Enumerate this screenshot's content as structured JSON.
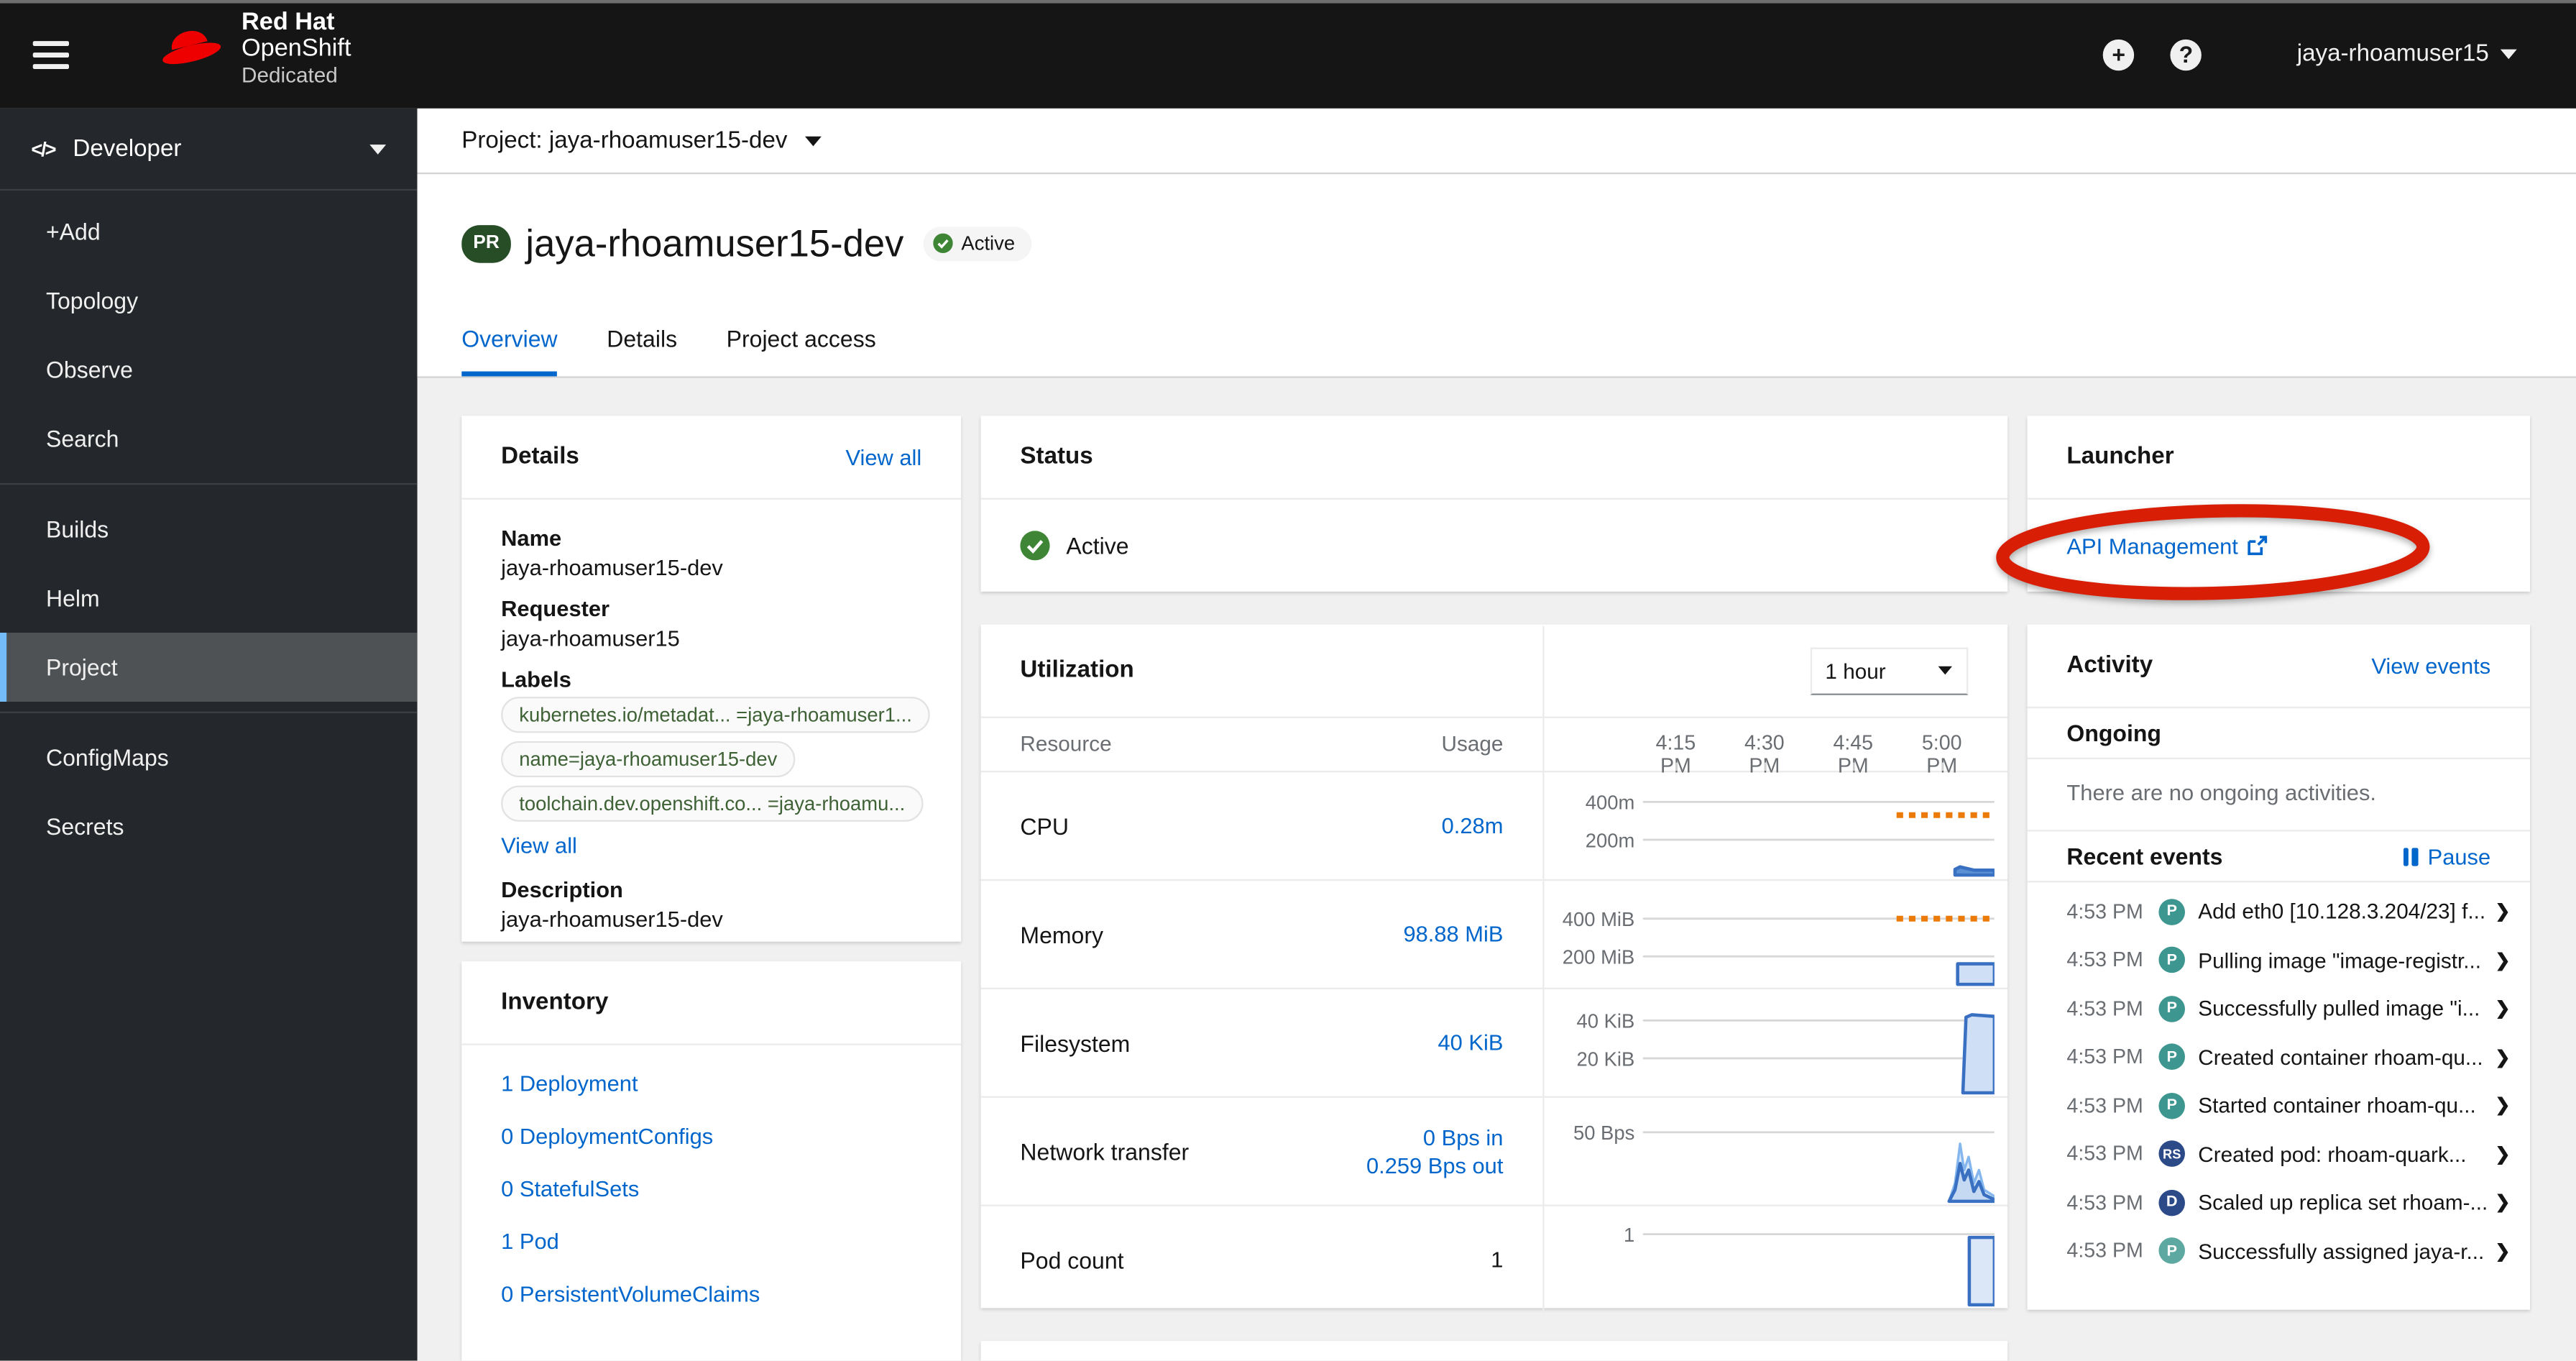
{
  "masthead": {
    "brand": {
      "line1": "Red Hat",
      "line2": "OpenShift",
      "line3": "Dedicated"
    },
    "user_menu": "jaya-rhoamuser15"
  },
  "sidebar": {
    "perspective": {
      "icon_text": "</>",
      "label": "Developer"
    },
    "sections": [
      {
        "items": [
          {
            "label": "+Add"
          },
          {
            "label": "Topology"
          },
          {
            "label": "Observe"
          },
          {
            "label": "Search"
          }
        ]
      },
      {
        "items": [
          {
            "label": "Builds"
          },
          {
            "label": "Helm"
          },
          {
            "label": "Project",
            "selected": true
          }
        ]
      },
      {
        "items": [
          {
            "label": "ConfigMaps"
          },
          {
            "label": "Secrets"
          }
        ]
      }
    ]
  },
  "context_bar": {
    "project_selector": "Project: jaya-rhoamuser15-dev"
  },
  "page_header": {
    "badge": "PR",
    "title": "jaya-rhoamuser15-dev",
    "status_badge": "Active"
  },
  "tabs": [
    {
      "label": "Overview",
      "active": true
    },
    {
      "label": "Details",
      "active": false
    },
    {
      "label": "Project access",
      "active": false
    }
  ],
  "details_card": {
    "title": "Details",
    "view_all": "View all",
    "fields": [
      {
        "label": "Name",
        "value": "jaya-rhoamuser15-dev"
      },
      {
        "label": "Requester",
        "value": "jaya-rhoamuser15"
      }
    ],
    "labels_label": "Labels",
    "labels": [
      "kubernetes.io/metadat...  =jaya-rhoamuser1...",
      "name=jaya-rhoamuser15-dev",
      "toolchain.dev.openshift.co...  =jaya-rhoamu..."
    ],
    "labels_view_all": "View all",
    "description_label": "Description",
    "description": "jaya-rhoamuser15-dev"
  },
  "status_card": {
    "title": "Status",
    "status": "Active"
  },
  "launcher_card": {
    "title": "Launcher",
    "link_label": "API Management"
  },
  "annotation": {
    "type": "ellipse-highlight",
    "target": "API Management link",
    "color": "#d81e05"
  },
  "utilization_card": {
    "title": "Utilization",
    "duration": "1 hour",
    "col_resource": "Resource",
    "col_usage": "Usage",
    "times": [
      "4:15 PM",
      "4:30 PM",
      "4:45 PM",
      "5:00 PM"
    ],
    "rows": [
      {
        "label": "CPU",
        "usage": [
          "0.28m"
        ],
        "usage_style": "link-style",
        "gridlines": [
          {
            "label": "400m",
            "y": 18
          },
          {
            "label": "200m",
            "y": 41
          }
        ],
        "limit": {
          "y": 26,
          "x0": 0.715,
          "x1": 1
        },
        "series": [
          {
            "stroke": "#3a70c2",
            "fill": "#5b8fd4",
            "w": 2,
            "points": [
              [
                0.885,
                59
              ],
              [
                0.9,
                57.5
              ],
              [
                0.92,
                58.5
              ],
              [
                0.94,
                59.5
              ],
              [
                1,
                59.5
              ],
              [
                1,
                62.5
              ],
              [
                0.885,
                62.5
              ]
            ]
          }
        ]
      },
      {
        "label": "Memory",
        "usage": [
          "98.88 MiB"
        ],
        "usage_style": "link-style",
        "gridlines": [
          {
            "label": "400 MiB",
            "y": 23
          },
          {
            "label": "200 MiB",
            "y": 46
          }
        ],
        "limit": {
          "y": 23,
          "x0": 0.715,
          "x1": 1
        },
        "series": [
          {
            "stroke": "#3a70c2",
            "fill": "#cfdff5",
            "w": 2,
            "points": [
              [
                0.893,
                50.5
              ],
              [
                1,
                50.5
              ],
              [
                1,
                63
              ],
              [
                0.893,
                63
              ]
            ]
          }
        ]
      },
      {
        "label": "Filesystem",
        "usage": [
          "40 KiB"
        ],
        "usage_style": "link-style",
        "gridlines": [
          {
            "label": "40 KiB",
            "y": 19
          },
          {
            "label": "20 KiB",
            "y": 42
          }
        ],
        "series": [
          {
            "stroke": "#3a70c2",
            "fill": "#cfdff5",
            "w": 2,
            "points": [
              [
                0.908,
                63
              ],
              [
                0.917,
                17
              ],
              [
                0.934,
                15.5
              ],
              [
                1,
                16.5
              ],
              [
                1,
                63
              ]
            ]
          }
        ]
      },
      {
        "label": "Network transfer",
        "usage": [
          "0 Bps in",
          "0.259 Bps out"
        ],
        "usage_style": "link-style",
        "gridlines": [
          {
            "label": "50 Bps",
            "y": 21
          }
        ],
        "series": [
          {
            "stroke": "#85b7ee",
            "fill": "#dcebfa",
            "w": 1.5,
            "points": [
              [
                0.868,
                63
              ],
              [
                0.885,
                52
              ],
              [
                0.9,
                28
              ],
              [
                0.912,
                44
              ],
              [
                0.925,
                36
              ],
              [
                0.94,
                52
              ],
              [
                0.955,
                44
              ],
              [
                0.97,
                56
              ],
              [
                1,
                60
              ],
              [
                1,
                63
              ]
            ]
          },
          {
            "stroke": "#3a70c2",
            "fill": "#c6d9f3",
            "w": 2,
            "points": [
              [
                0.868,
                63
              ],
              [
                0.885,
                56
              ],
              [
                0.9,
                40
              ],
              [
                0.912,
                50
              ],
              [
                0.925,
                44
              ],
              [
                0.94,
                57
              ],
              [
                0.955,
                51
              ],
              [
                0.97,
                59
              ],
              [
                1,
                62
              ],
              [
                1,
                63
              ]
            ]
          }
        ]
      },
      {
        "label": "Pod count",
        "usage": [
          "1"
        ],
        "usage_style": "plain",
        "gridlines": [
          {
            "label": "1",
            "y": 17
          }
        ],
        "series": [
          {
            "stroke": "#3a70c2",
            "fill": "#dbe6f7",
            "w": 2,
            "points": [
              [
                0.927,
                19
              ],
              [
                1,
                19
              ],
              [
                1,
                60
              ],
              [
                0.927,
                60
              ]
            ]
          }
        ]
      }
    ]
  },
  "activity_card": {
    "title": "Activity",
    "view_events": "View events",
    "ongoing_label": "Ongoing",
    "ongoing_empty": "There are no ongoing activities.",
    "recent_label": "Recent events",
    "pause_label": "Pause",
    "events": [
      {
        "time": "4:53 PM",
        "badge": "P",
        "badge_color": "#3d9690",
        "text": "Add eth0 [10.128.3.204/23] f..."
      },
      {
        "time": "4:53 PM",
        "badge": "P",
        "badge_color": "#3d9690",
        "text": "Pulling image \"image-registr..."
      },
      {
        "time": "4:53 PM",
        "badge": "P",
        "badge_color": "#3d9690",
        "text": "Successfully pulled image \"i..."
      },
      {
        "time": "4:53 PM",
        "badge": "P",
        "badge_color": "#3d9690",
        "text": "Created container rhoam-qu..."
      },
      {
        "time": "4:53 PM",
        "badge": "P",
        "badge_color": "#3d9690",
        "text": "Started container rhoam-qu..."
      },
      {
        "time": "4:53 PM",
        "badge": "RS",
        "badge_color": "#2b4a87",
        "text": "Created pod: rhoam-quark..."
      },
      {
        "time": "4:53 PM",
        "badge": "D",
        "badge_color": "#2b4a87",
        "text": "Scaled up replica set rhoam-..."
      },
      {
        "time": "4:53 PM",
        "badge": "P",
        "badge_color": "#5ea8a2",
        "text": "Successfully assigned jaya-r..."
      }
    ]
  },
  "inventory_card": {
    "title": "Inventory",
    "links": [
      "1 Deployment",
      "0 DeploymentConfigs",
      "0 StatefulSets",
      "1 Pod",
      "0 PersistentVolumeClaims"
    ]
  },
  "colors": {
    "accent_blue": "#0066cc",
    "status_green": "#3e8635",
    "limit_orange": "#ec7a08",
    "chart_blue": "#3a70c2",
    "annotation_red": "#d81e05"
  }
}
